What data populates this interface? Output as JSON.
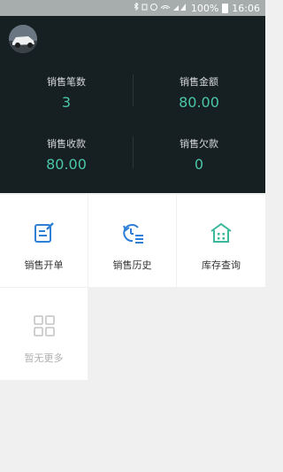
{
  "status_bar": {
    "battery": "100%",
    "time": "16:06",
    "icons": [
      "bluetooth-icon",
      "vibrate-icon",
      "alarm-icon",
      "wifi-icon",
      "signal-icon",
      "battery-icon"
    ]
  },
  "header": {
    "avatar": "car-avatar",
    "stats": [
      {
        "label": "销售笔数",
        "value": "3"
      },
      {
        "label": "销售金额",
        "value": "80.00"
      },
      {
        "label": "销售收款",
        "value": "80.00"
      },
      {
        "label": "销售欠款",
        "value": "0"
      }
    ]
  },
  "menu": {
    "items": [
      {
        "label": "销售开单",
        "icon": "edit-document-icon"
      },
      {
        "label": "销售历史",
        "icon": "history-list-icon"
      },
      {
        "label": "库存查询",
        "icon": "warehouse-icon"
      },
      {
        "label": "暂无更多",
        "icon": "grid-icon"
      }
    ]
  },
  "colors": {
    "header_bg": "#161f22",
    "accent": "#4ac6a8",
    "icon_blue": "#2f7fd6",
    "icon_teal": "#3cb89a"
  }
}
